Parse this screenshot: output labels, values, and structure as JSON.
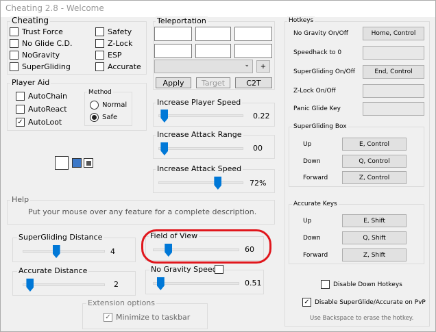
{
  "window": {
    "title": "Cheating 2.8  -  Welcome"
  },
  "cheating": {
    "title": "Cheating",
    "items": [
      {
        "label": "Trust Force",
        "checked": false
      },
      {
        "label": "No Glide C.D.",
        "checked": false
      },
      {
        "label": "NoGravity",
        "checked": false
      },
      {
        "label": "SuperGliding",
        "checked": false
      },
      {
        "label": "Safety",
        "checked": false
      },
      {
        "label": "Z-Lock",
        "checked": false
      },
      {
        "label": "ESP",
        "checked": false
      },
      {
        "label": "Accurate",
        "checked": false
      }
    ]
  },
  "player_aid": {
    "title": "Player Aid",
    "items": [
      {
        "label": "AutoChain",
        "checked": false
      },
      {
        "label": "AutoReact",
        "checked": false
      },
      {
        "label": "AutoLoot",
        "checked": true
      }
    ],
    "method": {
      "title": "Method",
      "options": [
        "Normal",
        "Safe"
      ],
      "selected": "Safe"
    }
  },
  "teleportation": {
    "title": "Teleportation",
    "plus_label": "+",
    "apply_label": "Apply",
    "target_label": "Target",
    "c2t_label": "C2T"
  },
  "sliders": {
    "player_speed": {
      "label": "Increase Player Speed",
      "value": "0.22",
      "level": 0.03
    },
    "attack_range": {
      "label": "Increase Attack Range",
      "value": "00",
      "level": 0.03
    },
    "attack_speed": {
      "label": "Increase Attack Speed",
      "value": "72%",
      "level": 0.72
    },
    "superglide_distance": {
      "label": "SuperGliding Distance",
      "value": "4",
      "level": 0.4
    },
    "accurate_distance": {
      "label": "Accurate Distance",
      "value": "2",
      "level": 0.05
    },
    "field_of_view": {
      "label": "Field of View",
      "value": "60",
      "level": 0.15
    },
    "no_gravity_speed": {
      "label": "No Gravity Speed",
      "value": "0.51",
      "level": 0.05
    }
  },
  "help": {
    "title": "Help",
    "text": "Put your mouse over any feature for a complete description."
  },
  "hotkeys": {
    "title": "Hotkeys",
    "rows": [
      {
        "label": "No Gravity On/Off",
        "key": "Home, Control"
      },
      {
        "label": "Speedhack to 0",
        "key": ""
      },
      {
        "label": "SuperGliding On/Off",
        "key": "End, Control"
      },
      {
        "label": "Z-Lock On/Off",
        "key": ""
      },
      {
        "label": "Panic Glide Key",
        "key": ""
      }
    ],
    "superglide_box": {
      "title": "SuperGliding Box",
      "rows": [
        {
          "label": "Up",
          "key": "E, Control"
        },
        {
          "label": "Down",
          "key": "Q, Control"
        },
        {
          "label": "Forward",
          "key": "Z, Control"
        }
      ]
    },
    "accurate_keys": {
      "title": "Accurate Keys",
      "rows": [
        {
          "label": "Up",
          "key": "E, Shift"
        },
        {
          "label": "Down",
          "key": "Q, Shift"
        },
        {
          "label": "Forward",
          "key": "Z, Shift"
        }
      ]
    },
    "disable_down": {
      "label": "Disable Down Hotkeys",
      "checked": false
    },
    "disable_superglide_pvp": {
      "label": "Disable SuperGlide/Accurate on PvP",
      "checked": true
    },
    "hint": "Use Backspace to erase the hotkey."
  },
  "extension": {
    "title": "Extension options",
    "minimize": {
      "label": "Minimize to taskbar",
      "checked": true
    }
  },
  "colors": {
    "slider_thumb": "#0078d7",
    "highlight": "#e0161c",
    "window_bg": "#f0f0f0"
  }
}
